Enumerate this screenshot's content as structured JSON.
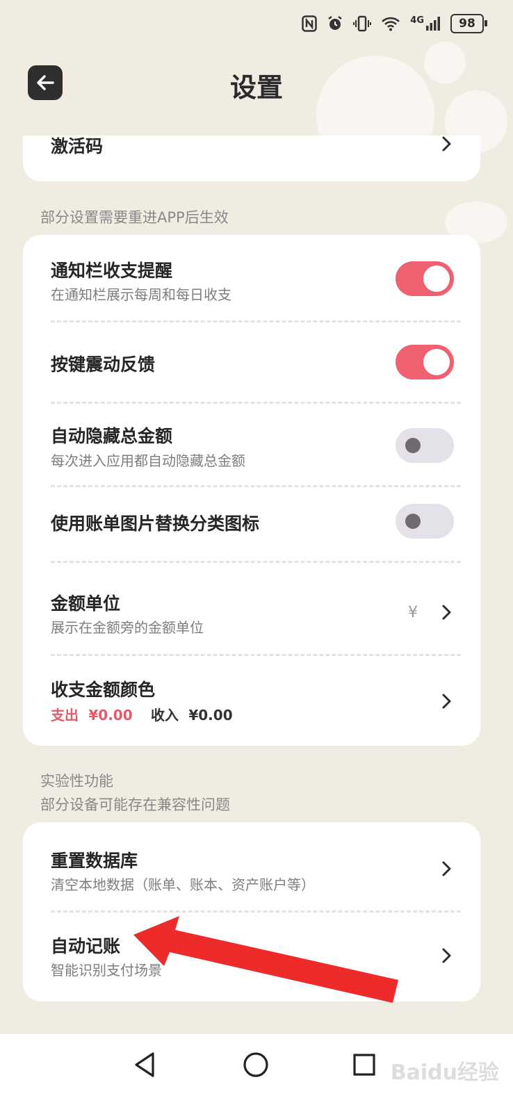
{
  "header": {
    "title": "设置"
  },
  "status": {
    "battery": "98",
    "network": "4G"
  },
  "top_card": {
    "activation_label": "激活码"
  },
  "section_notice": "部分设置需要重进APP后生效",
  "settings": {
    "notify_title": "通知栏收支提醒",
    "notify_sub": "在通知栏展示每周和每日收支",
    "notify_on": true,
    "vibrate_title": "按键震动反馈",
    "vibrate_on": true,
    "hide_title": "自动隐藏总金额",
    "hide_sub": "每次进入应用都自动隐藏总金额",
    "hide_on": false,
    "billimg_title": "使用账单图片替换分类图标",
    "billimg_on": false,
    "unit_title": "金额单位",
    "unit_sub": "展示在金额旁的金额单位",
    "unit_value": "¥",
    "color_title": "收支金额颜色",
    "expense_label": "支出",
    "expense_value": "¥0.00",
    "income_label": "收入",
    "income_value": "¥0.00"
  },
  "experimental": {
    "label": "实验性功能",
    "sub": "部分设备可能存在兼容性问题",
    "reset_title": "重置数据库",
    "reset_sub": "清空本地数据（账单、账本、资产账户等）",
    "auto_title": "自动记账",
    "auto_sub": "智能识别支付场景"
  },
  "watermark": "Baidu经验",
  "colors": {
    "accent": "#ef6170",
    "expense": "#e35a6a",
    "annotation_arrow": "#ee2b2b"
  }
}
